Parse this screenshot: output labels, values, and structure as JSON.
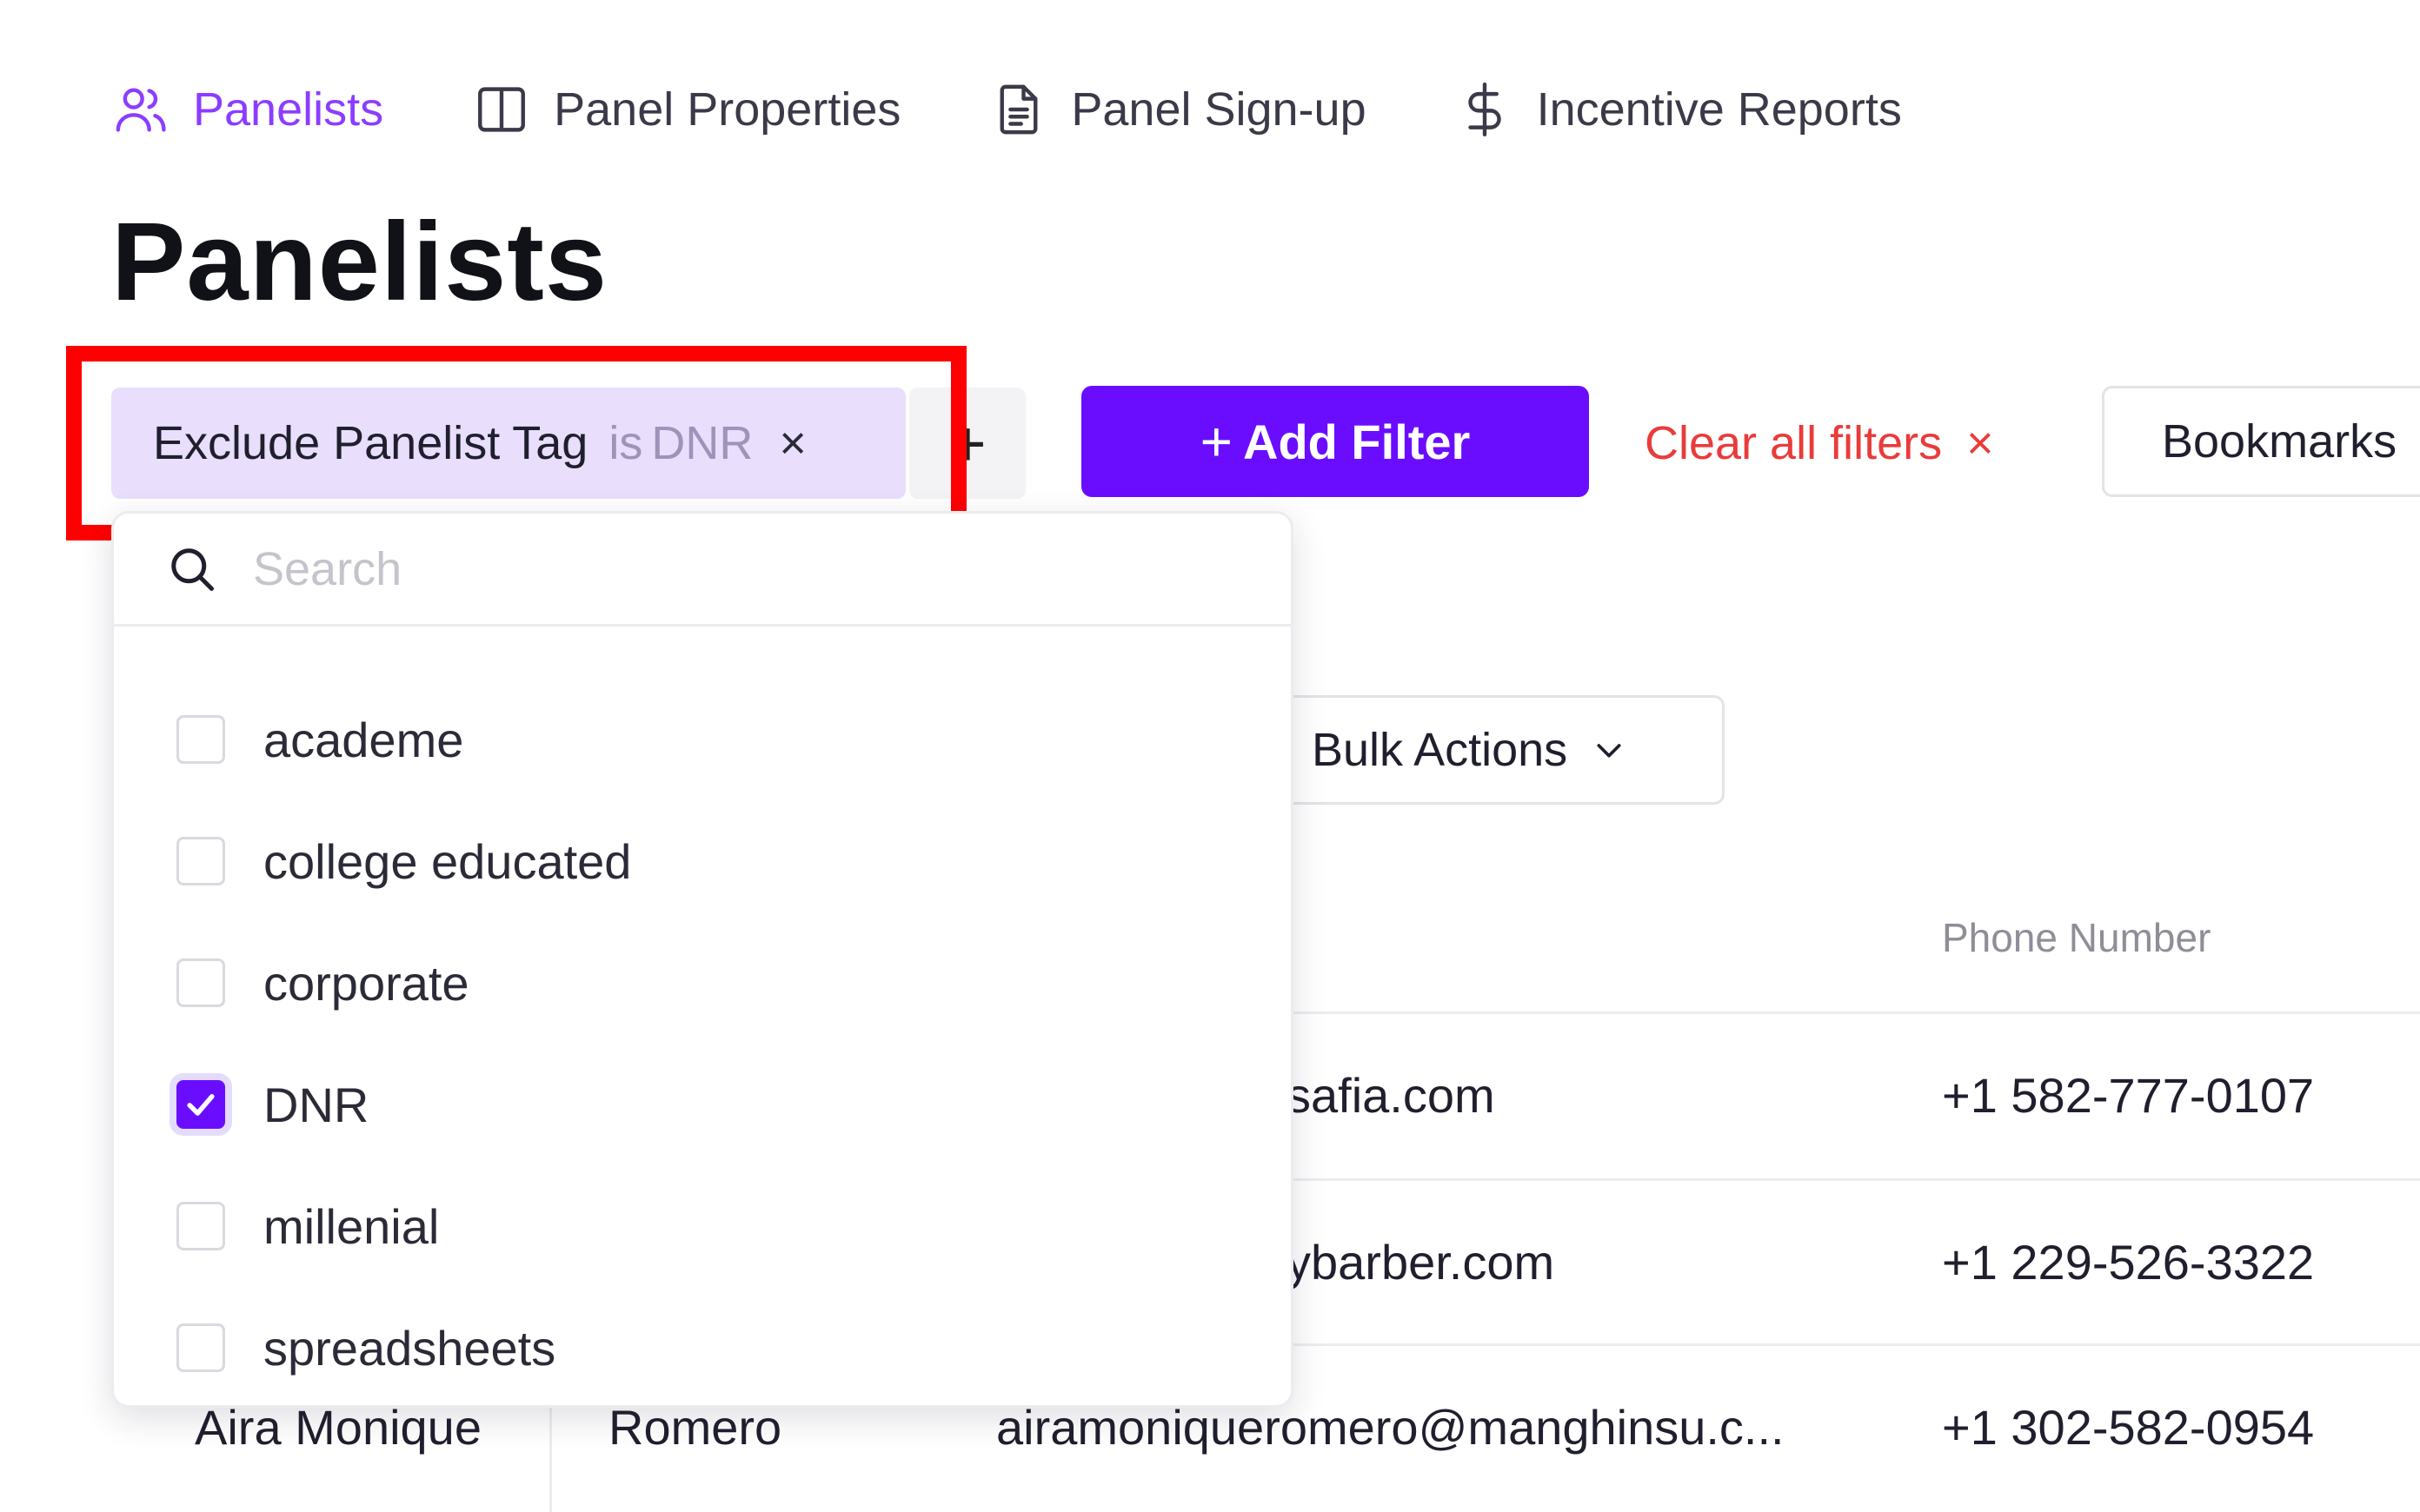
{
  "nav": {
    "items": [
      {
        "label": "Panelists",
        "icon": "users-icon",
        "active": true
      },
      {
        "label": "Panel Properties",
        "icon": "columns-icon",
        "active": false
      },
      {
        "label": "Panel Sign-up",
        "icon": "document-icon",
        "active": false
      },
      {
        "label": "Incentive Reports",
        "icon": "dollar-icon",
        "active": false
      }
    ]
  },
  "page": {
    "title": "Panelists"
  },
  "filter": {
    "field": "Exclude Panelist Tag",
    "operator": "is",
    "value": "DNR",
    "remove_symbol": "×",
    "add_symbol": "+"
  },
  "toolbar": {
    "add_filter_plus": "+",
    "add_filter_label": "Add Filter",
    "clear_label": "Clear all filters",
    "clear_symbol": "×",
    "bookmarks_label": "Bookmarks"
  },
  "bulk_actions": {
    "label": "Bulk Actions"
  },
  "dropdown": {
    "search_placeholder": "Search",
    "options": [
      {
        "label": "academe",
        "checked": false
      },
      {
        "label": "college educated",
        "checked": false
      },
      {
        "label": "corporate",
        "checked": false
      },
      {
        "label": "DNR",
        "checked": true
      },
      {
        "label": "millenial",
        "checked": false
      },
      {
        "label": "spreadsheets",
        "checked": false
      }
    ]
  },
  "table": {
    "headers": {
      "phone": "Phone Number"
    },
    "rows": [
      {
        "email": "safia.com",
        "phone": "+1 582-777-0107"
      },
      {
        "email": "ybarber.com",
        "phone": "+1 229-526-3322"
      },
      {
        "first_name": "Aira Monique",
        "last_name": "Romero",
        "email": "airamoniqueromero@manghinsu.c...",
        "phone": "+1 302-582-0954"
      }
    ]
  },
  "colors": {
    "accent": "#6a0dff",
    "nav_active": "#8b3dff",
    "danger": "#ea3b3b",
    "chip_bg": "#e9defc",
    "highlight": "#ff0000"
  }
}
